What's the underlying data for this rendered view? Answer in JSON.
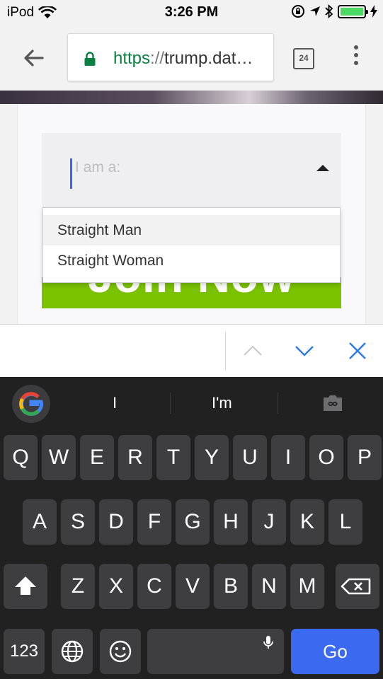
{
  "status_bar": {
    "carrier": "iPod",
    "time": "3:26 PM",
    "battery_level": 1.0,
    "battery_color": "#4cd964"
  },
  "browser": {
    "url_scheme": "https",
    "url_separator": "://",
    "url_host": "trump.dat…",
    "tab_count": "24",
    "url_scheme_color": "#0b8043"
  },
  "form": {
    "select_placeholder": "I am a:",
    "dropdown_options": [
      "Straight Man",
      "Straight Woman"
    ],
    "join_button_label": "Join Now",
    "join_button_color": "#7ac200"
  },
  "keyboard": {
    "suggestions": [
      "I",
      "I'm"
    ],
    "rows": [
      [
        "Q",
        "W",
        "E",
        "R",
        "T",
        "Y",
        "U",
        "I",
        "O",
        "P"
      ],
      [
        "A",
        "S",
        "D",
        "F",
        "G",
        "H",
        "J",
        "K",
        "L"
      ],
      [
        "Z",
        "X",
        "C",
        "V",
        "B",
        "N",
        "M"
      ]
    ],
    "numbers_label": "123",
    "go_label": "Go",
    "go_color": "#3b6af0"
  }
}
